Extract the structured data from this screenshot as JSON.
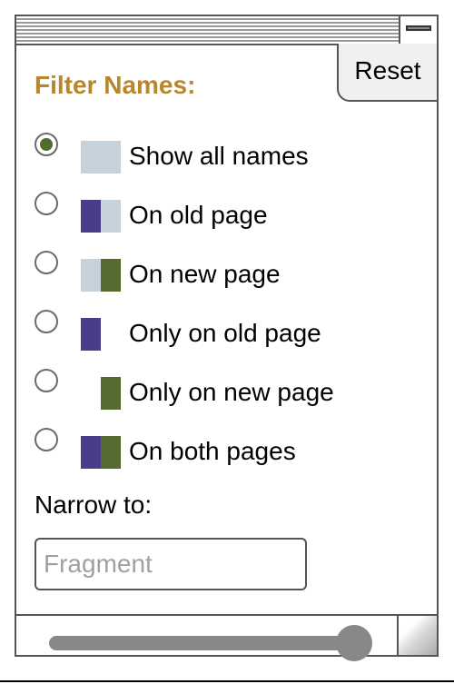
{
  "window": {
    "reset_label": "Reset"
  },
  "filter": {
    "title": "Filter Names:",
    "options": [
      {
        "label": "Show all names",
        "checked": true,
        "swatch": [
          "old_bg",
          "new_bg"
        ]
      },
      {
        "label": "On old page",
        "checked": false,
        "swatch": [
          "old",
          "new_bg"
        ]
      },
      {
        "label": "On new page",
        "checked": false,
        "swatch": [
          "old_bg",
          "new"
        ]
      },
      {
        "label": "Only on old page",
        "checked": false,
        "swatch": [
          "old",
          "none"
        ]
      },
      {
        "label": "Only on new page",
        "checked": false,
        "swatch": [
          "none",
          "new"
        ]
      },
      {
        "label": "On both pages",
        "checked": false,
        "swatch": [
          "old",
          "new"
        ]
      }
    ]
  },
  "narrow": {
    "label": "Narrow to:",
    "placeholder": "Fragment",
    "value": ""
  },
  "slider": {
    "value": 1.0
  },
  "colors": {
    "title": "#b8862b",
    "old_page": "#483d8b",
    "new_page": "#556b2f",
    "light_swatch": "#c6d2db",
    "radio_checked": "#4e6e2e"
  },
  "icons": {
    "titlebar_button": "minimize-icon",
    "corner": "resize-grip-icon"
  }
}
